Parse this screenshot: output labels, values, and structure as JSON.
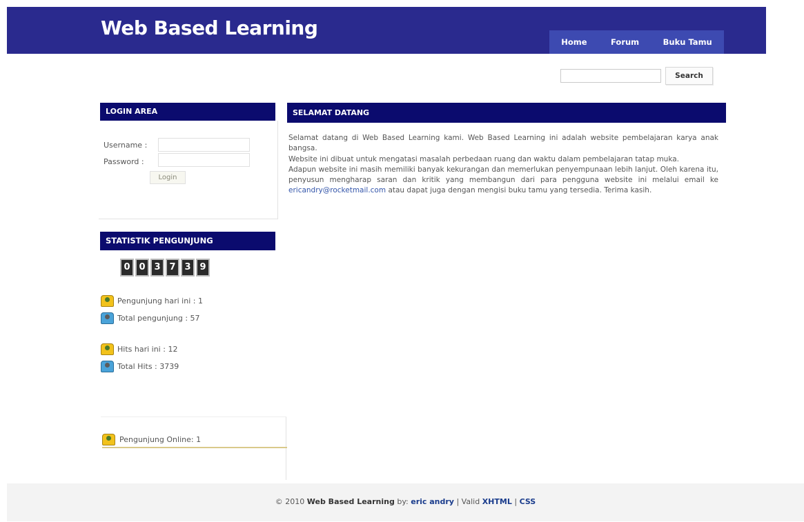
{
  "header": {
    "site_title": "Web Based Learning",
    "nav": [
      "Home",
      "Forum",
      "Buku Tamu"
    ],
    "bg_color": "#2a2a8e"
  },
  "search": {
    "button_label": "Search",
    "value": ""
  },
  "login": {
    "title": "LOGIN AREA",
    "username_label": "Username :",
    "password_label": "Password :",
    "button_label": "Login"
  },
  "stats": {
    "title": "STATISTIK PENGUNJUNG",
    "counter_digits": [
      "0",
      "0",
      "3",
      "7",
      "3",
      "9"
    ],
    "visitors_today": "Pengunjung hari ini : 1",
    "total_visitors": "Total pengunjung : 57",
    "hits_today": "Hits hari ini : 12",
    "total_hits": "Total Hits : 3739",
    "online": "Pengunjung Online: 1"
  },
  "welcome": {
    "title": "SELAMAT DATANG",
    "p1": "Selamat datang di Web Based Learning kami. Web Based Learning ini adalah website pembelajaran karya anak bangsa.",
    "p2": "Website ini dibuat untuk mengatasi masalah perbedaan ruang dan waktu dalam pembelajaran tatap muka.",
    "p3_before": "Adapun website ini masih memiliki banyak kekurangan dan memerlukan penyempunaan lebih lanjut. Oleh karena itu, penyusun mengharap saran dan kritik yang membangun dari para pengguna website ini melalui email ke",
    "email": "ericandry@rocketmail.com",
    "p3_after": "atau dapat juga dengan mengisi buku tamu yang tersedia. Terima kasih."
  },
  "footer": {
    "copyright": "© 2010",
    "site": "Web Based Learning",
    "by": "by:",
    "author": "eric andry",
    "valid": "| Valid",
    "xhtml": "XHTML",
    "sep": "|",
    "css": "CSS"
  }
}
